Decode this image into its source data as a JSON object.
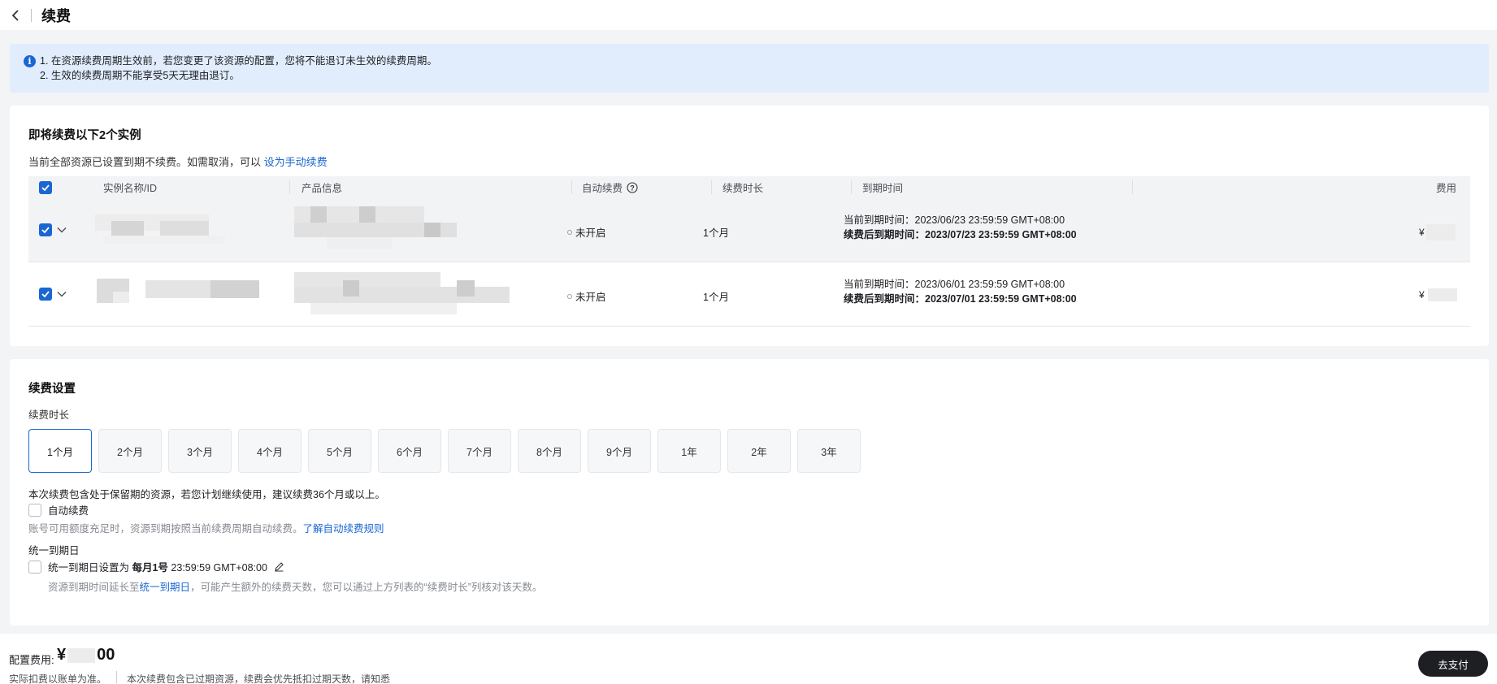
{
  "header": {
    "title": "续费"
  },
  "notice": {
    "line1": "1. 在资源续费周期生效前，若您变更了该资源的配置，您将不能退订未生效的续费周期。",
    "line2": "2. 生效的续费周期不能享受5天无理由退订。"
  },
  "instances": {
    "title": "即将续费以下2个实例",
    "subtext": "当前全部资源已设置到期不续费。如需取消，可以 ",
    "subtext_link": "设为手动续费",
    "columns": {
      "name": "实例名称/ID",
      "product": "产品信息",
      "auto_renew": "自动续费",
      "duration": "续费时长",
      "expire": "到期时间",
      "cost": "费用"
    },
    "rows": [
      {
        "auto_renew": "未开启",
        "duration": "1个月",
        "current_label": "当前到期时间：",
        "current_value": "2023/06/23 23:59:59 GMT+08:00",
        "after_label": "续费后到期时间：",
        "after_value": "2023/07/23 23:59:59 GMT+08:00",
        "cost_prefix": "¥"
      },
      {
        "auto_renew": "未开启",
        "duration": "1个月",
        "current_label": "当前到期时间：",
        "current_value": "2023/06/01 23:59:59 GMT+08:00",
        "after_label": "续费后到期时间：",
        "after_value": "2023/07/01 23:59:59 GMT+08:00",
        "cost_prefix": "¥"
      }
    ]
  },
  "settings": {
    "title": "续费设置",
    "duration_label": "续费时长",
    "durations": [
      "1个月",
      "2个月",
      "3个月",
      "4个月",
      "5个月",
      "6个月",
      "7个月",
      "8个月",
      "9个月",
      "1年",
      "2年",
      "3年"
    ],
    "selected_duration": "1个月",
    "retention_note": "本次续费包含处于保留期的资源，若您计划继续使用，建议续费36个月或以上。",
    "auto_renew_label": "自动续费",
    "auto_renew_checked": false,
    "auto_renew_desc": "账号可用额度充足时，资源到期按照当前续费周期自动续费。",
    "auto_renew_link": "了解自动续费规则",
    "unified_title": "统一到期日",
    "unified_prefix": "统一到期日设置为 ",
    "unified_day": "每月1号",
    "unified_time": " 23:59:59 GMT+08:00",
    "unified_checked": false,
    "unified_desc_a": "资源到期时间延长至",
    "unified_desc_link": "统一到期日",
    "unified_desc_b": "，可能产生额外的续费天数，您可以通过上方列表的“续费时长”列核对该天数。"
  },
  "footer": {
    "cost_label": "配置费用:",
    "cost_prefix": "¥",
    "cost_suffix": "00",
    "note1": "实际扣费以账单为准。",
    "note2": "本次续费包含已过期资源，续费会优先抵扣过期天数，请知悉",
    "pay_button": "去支付"
  },
  "colors": {
    "accent": "#1a66d2",
    "pay_button": "#1d1f23",
    "notice_bg": "#e1edfc"
  },
  "icons": [
    "chevron-left-icon",
    "info-icon",
    "help-circle-icon",
    "chevron-down-icon",
    "edit-pencil-icon",
    "checkbox-icon"
  ]
}
